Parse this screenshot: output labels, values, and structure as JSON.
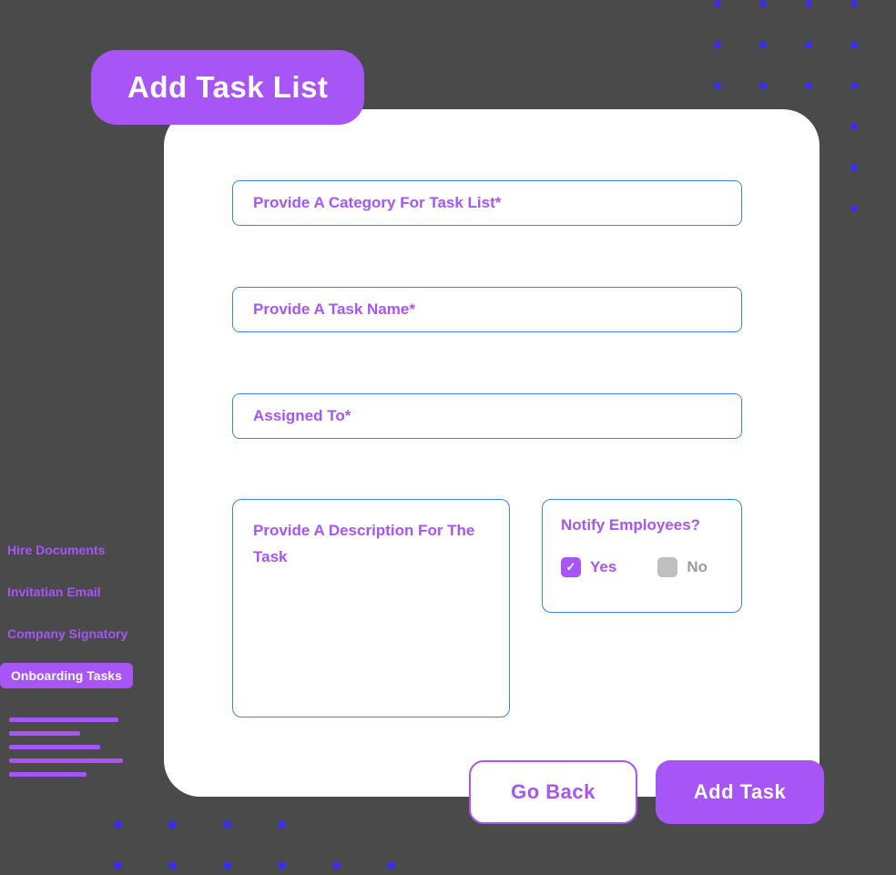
{
  "header": {
    "title": "Add Task List"
  },
  "form": {
    "category_placeholder": "Provide A Category For Task List*",
    "taskname_placeholder": "Provide A Task Name*",
    "assigned_placeholder": "Assigned To*",
    "description_placeholder": "Provide A Description For The Task",
    "notify": {
      "title": "Notify Employees?",
      "yes_label": "Yes",
      "no_label": "No",
      "selected": "yes"
    }
  },
  "buttons": {
    "go_back": "Go Back",
    "add_task": "Add Task"
  },
  "sidebar": {
    "items": [
      {
        "label": "Hire Documents",
        "active": false
      },
      {
        "label": "Invitatian Email",
        "active": false
      },
      {
        "label": "Company Signatory",
        "active": false
      },
      {
        "label": "Onboarding Tasks",
        "active": true
      }
    ]
  },
  "colors": {
    "purple": "#a855f7",
    "blue_border": "#3b82f6",
    "dot_blue": "#3b2ee8",
    "bg": "#4a4a4a"
  }
}
